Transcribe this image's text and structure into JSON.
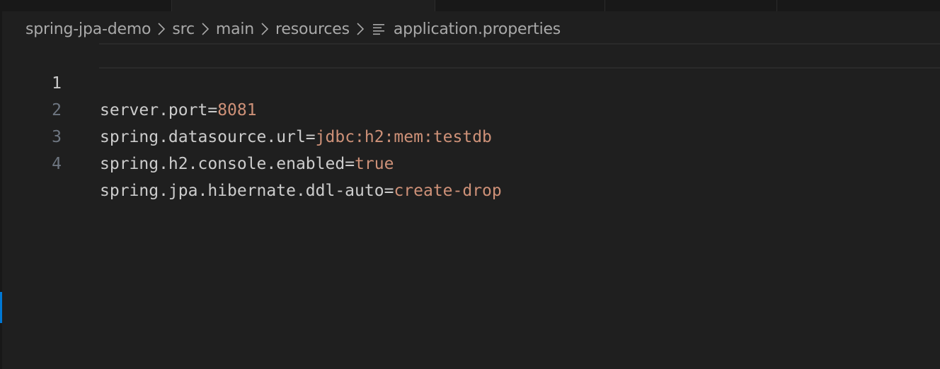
{
  "breadcrumb": {
    "items": [
      "spring-jpa-demo",
      "src",
      "main",
      "resources"
    ],
    "file": "application.properties",
    "file_icon": "properties-file-icon"
  },
  "editor": {
    "lines": [
      {
        "number": "1",
        "key": "server.port",
        "eq": "=",
        "value": "8081",
        "active": true
      },
      {
        "number": "2",
        "key": "spring.datasource.url",
        "eq": "=",
        "value": "jdbc:h2:mem:testdb",
        "active": false
      },
      {
        "number": "3",
        "key": "spring.h2.console.enabled",
        "eq": "=",
        "value": "true",
        "active": false
      },
      {
        "number": "4",
        "key": "spring.jpa.hibernate.ddl-auto",
        "eq": "=",
        "value": "create-drop",
        "active": false
      }
    ]
  },
  "colors": {
    "background": "#1f1f1f",
    "key": "#cccccc",
    "value": "#ce9178",
    "line_number": "#6e7681",
    "active_line_number": "#cccccc",
    "accent": "#0078d4"
  }
}
